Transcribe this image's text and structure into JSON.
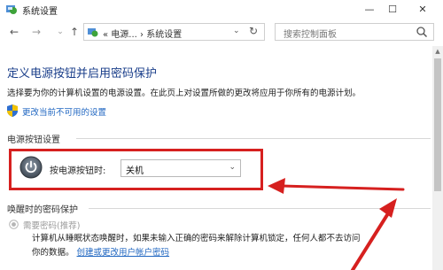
{
  "window": {
    "title": "系统设置"
  },
  "titlebar": {
    "min": "—",
    "max": "☐",
    "close": "✕"
  },
  "nav": {
    "address_text": "«  电源...  ›  系统设置",
    "search_placeholder": "搜索控制面板"
  },
  "page": {
    "title": "定义电源按钮并启用密码保护",
    "description": "选择要为你的计算机设置的电源设置。在此页上对设置所做的更改将应用于你所有的电源计划。",
    "change_link": "更改当前不可用的设置"
  },
  "power_section": {
    "label": "电源按钮设置",
    "row_label": "按电源按钮时:",
    "selected_value": "关机"
  },
  "password_section": {
    "label": "唤醒时的密码保护",
    "radio_label": "需要密码(推荐)",
    "text_line1": "计算机从睡眠状态唤醒时，如果未输入正确的密码来解除计算机锁定，任何人都不去访问",
    "text_line2_prefix": "你的数据。",
    "text_line2_link": "创建或更改用户帐户密码"
  },
  "colors": {
    "title_blue": "#1a3e8a",
    "link_blue": "#1f66c1",
    "annotation_red": "#d6201f"
  }
}
